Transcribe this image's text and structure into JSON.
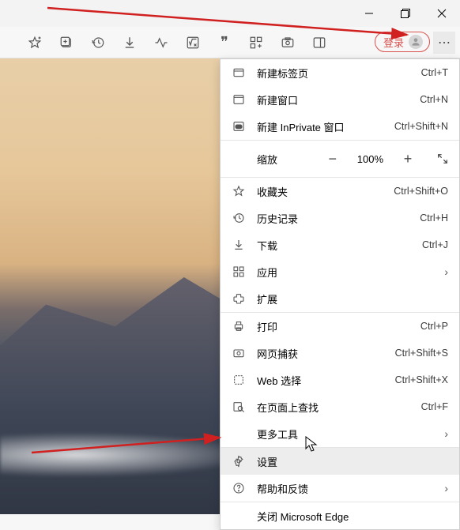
{
  "window": {
    "minimize": "—",
    "maximize": "❐",
    "close": "✕"
  },
  "login": {
    "label": "登录"
  },
  "zoom": {
    "label": "缩放",
    "value": "100%"
  },
  "menu": {
    "new_tab": {
      "label": "新建标签页",
      "shortcut": "Ctrl+T"
    },
    "new_window": {
      "label": "新建窗口",
      "shortcut": "Ctrl+N"
    },
    "new_inprivate": {
      "label": "新建 InPrivate 窗口",
      "shortcut": "Ctrl+Shift+N"
    },
    "favorites": {
      "label": "收藏夹",
      "shortcut": "Ctrl+Shift+O"
    },
    "history": {
      "label": "历史记录",
      "shortcut": "Ctrl+H"
    },
    "downloads": {
      "label": "下载",
      "shortcut": "Ctrl+J"
    },
    "apps": {
      "label": "应用"
    },
    "extensions": {
      "label": "扩展"
    },
    "print": {
      "label": "打印",
      "shortcut": "Ctrl+P"
    },
    "web_capture": {
      "label": "网页捕获",
      "shortcut": "Ctrl+Shift+S"
    },
    "web_select": {
      "label": "Web 选择",
      "shortcut": "Ctrl+Shift+X"
    },
    "find": {
      "label": "在页面上查找",
      "shortcut": "Ctrl+F"
    },
    "more_tools": {
      "label": "更多工具"
    },
    "settings": {
      "label": "设置"
    },
    "help": {
      "label": "帮助和反馈"
    },
    "close_edge": {
      "label": "关闭 Microsoft Edge"
    }
  }
}
